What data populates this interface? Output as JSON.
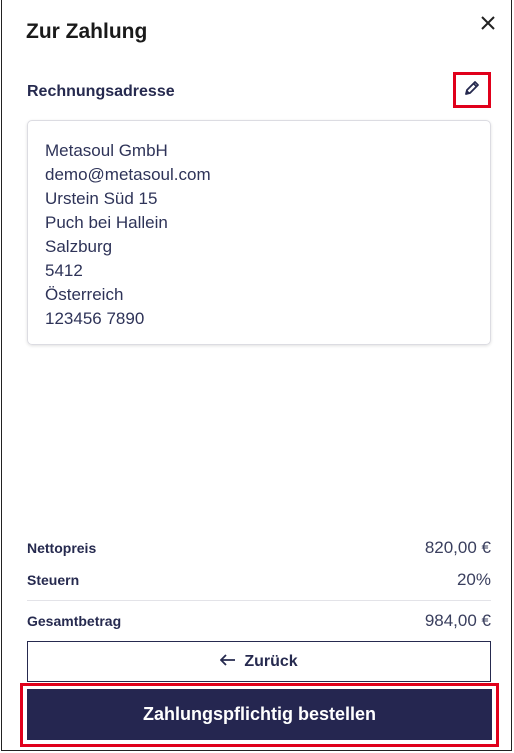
{
  "dialog": {
    "title": "Zur Zahlung",
    "close_icon": "close-icon"
  },
  "billing": {
    "section_label": "Rechnungsadresse",
    "edit_icon": "pencil-icon",
    "address_lines": [
      "Metasoul GmbH",
      "demo@metasoul.com",
      "Urstein Süd 15",
      "Puch bei Hallein",
      "Salzburg",
      "5412",
      "Österreich",
      "123456 7890"
    ]
  },
  "summary": {
    "net_label": "Nettopreis",
    "net_value": "820,00 €",
    "tax_label": "Steuern",
    "tax_value": "20%",
    "total_label": "Gesamtbetrag",
    "total_value": "984,00 €"
  },
  "actions": {
    "back_label": "Zurück",
    "back_icon": "arrow-left-icon",
    "order_label": "Zahlungspflichtig bestellen"
  },
  "colors": {
    "primary": "#252650",
    "highlight": "#e0001b"
  }
}
